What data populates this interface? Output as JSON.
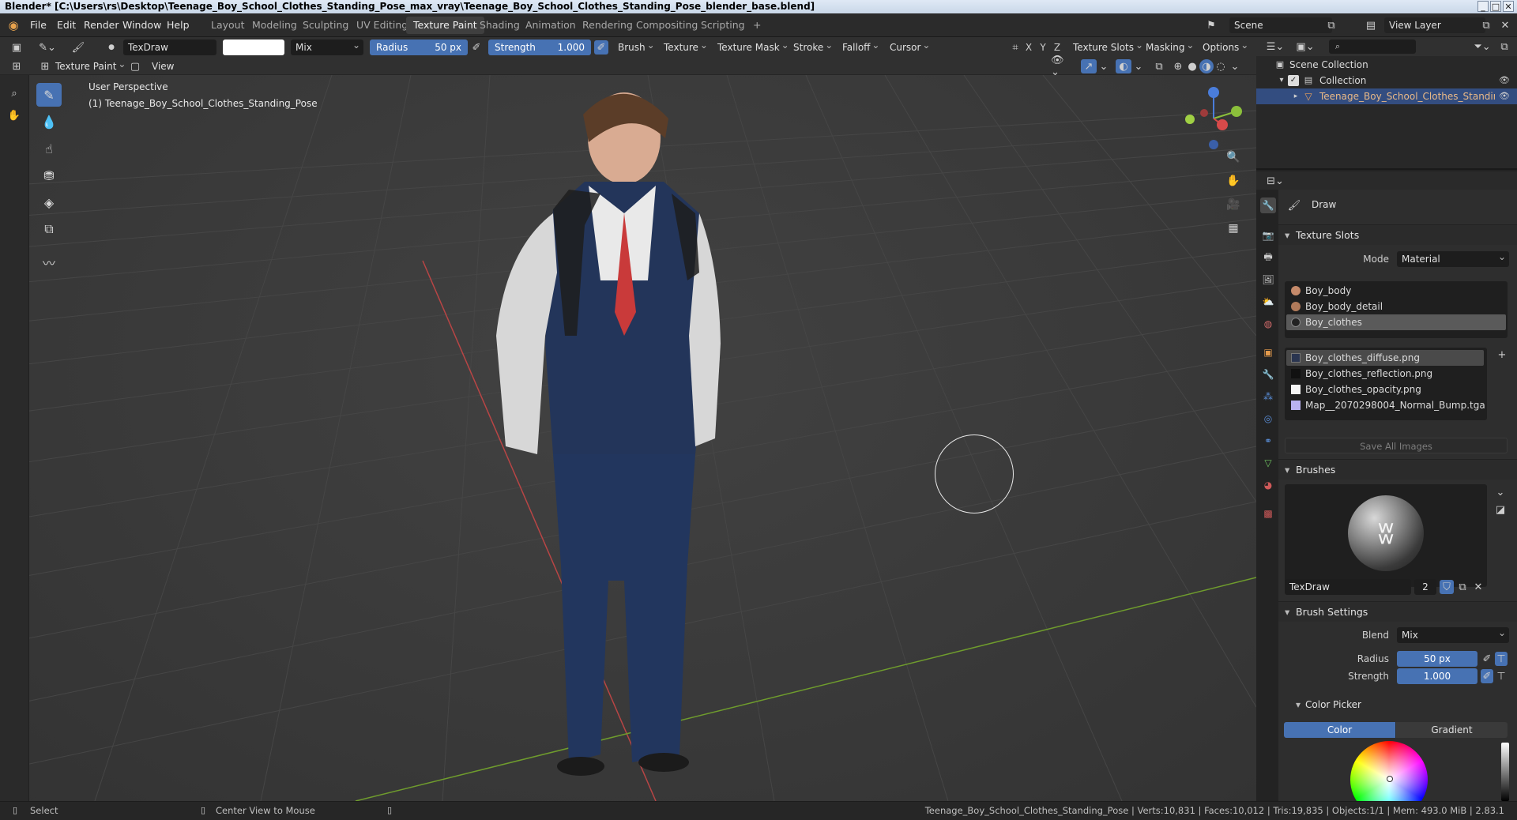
{
  "window": {
    "title": "Blender* [C:\\Users\\rs\\Desktop\\Teenage_Boy_School_Clothes_Standing_Pose_max_vray\\Teenage_Boy_School_Clothes_Standing_Pose_blender_base.blend]",
    "minimize": "_",
    "maximize": "□",
    "close": "✕"
  },
  "menus": [
    "File",
    "Edit",
    "Render",
    "Window",
    "Help"
  ],
  "workspaces": [
    "Layout",
    "Modeling",
    "Sculpting",
    "UV Editing",
    "Texture Paint",
    "Shading",
    "Animation",
    "Rendering",
    "Compositing",
    "Scripting",
    "+"
  ],
  "active_workspace": "Texture Paint",
  "scene": {
    "name": "Scene",
    "view_layer": "View Layer"
  },
  "tool_header": {
    "brush_name": "TexDraw",
    "blend": "Mix",
    "radius_label": "Radius",
    "radius_value": "50 px",
    "strength_label": "Strength",
    "strength_value": "1.000",
    "menus": [
      "Brush",
      "Texture",
      "Texture Mask",
      "Stroke",
      "Falloff",
      "Cursor"
    ],
    "axes": [
      "X",
      "Y",
      "Z"
    ],
    "right_menus": [
      "Texture Slots",
      "Masking",
      "Options"
    ]
  },
  "view_header": {
    "mode": "Texture Paint",
    "view": "View"
  },
  "viewport": {
    "line1": "User Perspective",
    "line2": "(1) Teenage_Boy_School_Clothes_Standing_Pose"
  },
  "outliner": {
    "root": "Scene Collection",
    "collection": "Collection",
    "object": "Teenage_Boy_School_Clothes_Standing_Pose"
  },
  "properties": {
    "tool_name": "Draw",
    "texture_slots": {
      "title": "Texture Slots",
      "mode_label": "Mode",
      "mode_value": "Material",
      "materials": [
        {
          "name": "Boy_body",
          "color": "#c58a6a"
        },
        {
          "name": "Boy_body_detail",
          "color": "#b07a5a"
        },
        {
          "name": "Boy_clothes",
          "color": "#222222"
        }
      ],
      "images": [
        {
          "name": "Boy_clothes_diffuse.png",
          "color": "#2a3550"
        },
        {
          "name": "Boy_clothes_reflection.png",
          "color": "#111111"
        },
        {
          "name": "Boy_clothes_opacity.png",
          "color": "#f5f5f5"
        },
        {
          "name": "Map__2070298004_Normal_Bump.tga",
          "color": "#b9b2f0"
        }
      ],
      "save_all": "Save All Images"
    },
    "brushes": {
      "title": "Brushes",
      "brush_name": "TexDraw",
      "users": "2"
    },
    "brush_settings": {
      "title": "Brush Settings",
      "blend_label": "Blend",
      "blend_value": "Mix",
      "radius_label": "Radius",
      "radius_value": "50 px",
      "strength_label": "Strength",
      "strength_value": "1.000"
    },
    "color_picker": {
      "title": "Color Picker",
      "tab_color": "Color",
      "tab_gradient": "Gradient"
    }
  },
  "statusbar": {
    "select": "Select",
    "center": "Center View to Mouse",
    "stats": "Teenage_Boy_School_Clothes_Standing_Pose | Verts:10,831 | Faces:10,012 | Tris:19,835 | Objects:1/1 | Mem: 493.0 MiB | 2.83.1"
  },
  "colors": {
    "accent": "#4772b3",
    "selected_object": "#e9b987",
    "axis_x": "#d84a4a",
    "axis_y": "#8bbf3b"
  }
}
